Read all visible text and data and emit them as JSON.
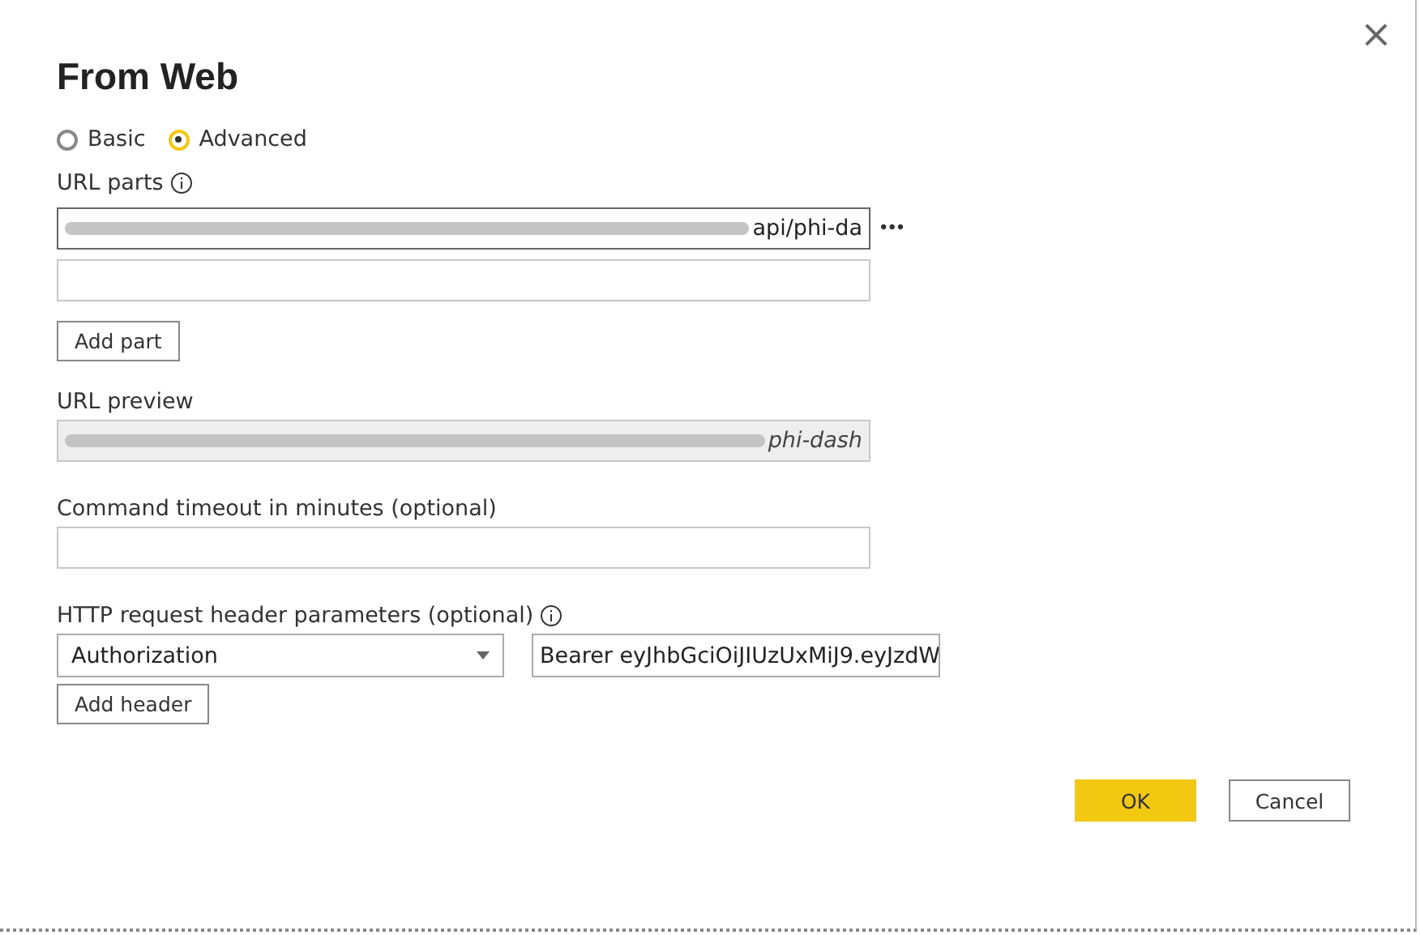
{
  "window": {
    "title": "From Web",
    "close": "×"
  },
  "modes": [
    {
      "label": "Basic",
      "selected": false
    },
    {
      "label": "Advanced",
      "selected": true
    }
  ],
  "url_parts": {
    "label": "URL parts",
    "parts": [
      {
        "value": "api/phi-da",
        "redacted": true
      },
      {
        "redacted": false
      }
    ],
    "more": "•••",
    "add_button": "Add part"
  },
  "url_preview": {
    "label": "URL preview",
    "value": "phi-dash",
    "redacted": true
  },
  "timeout": {
    "label": "Command timeout in minutes (optional)"
  },
  "headers": {
    "label": "HTTP request header parameters (optional)",
    "name": "Authorization",
    "value": "Bearer eyJhbGciOiJIUzUxMiJ9.eyJzdW",
    "add_button": "Add header"
  },
  "buttons": [
    {
      "label": "OK",
      "kind": "primary"
    },
    {
      "label": "Cancel",
      "kind": "secondary"
    }
  ]
}
